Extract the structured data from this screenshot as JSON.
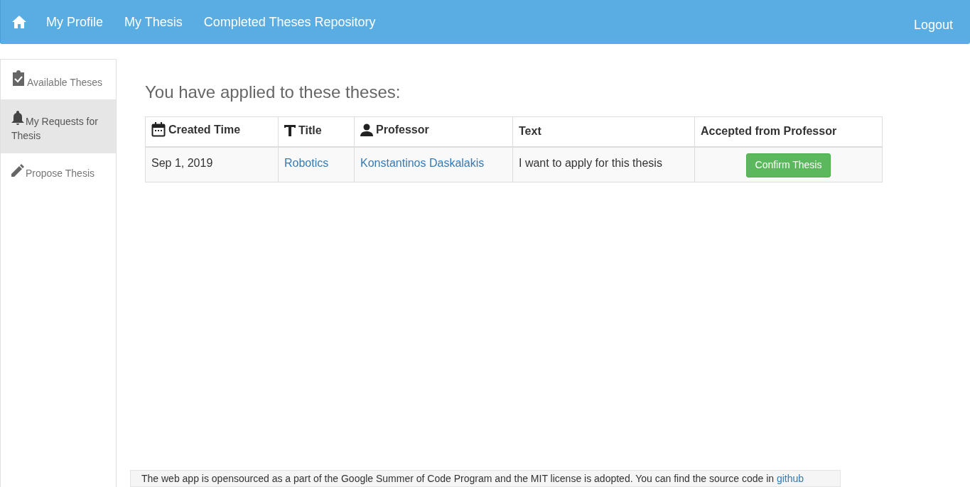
{
  "navbar": {
    "links": [
      {
        "label": "My Profile"
      },
      {
        "label": "My Thesis"
      },
      {
        "label": "Completed Theses Repository"
      }
    ],
    "logout": "Logout"
  },
  "sidebar": {
    "items": [
      {
        "kind": "clipboard",
        "label": "Available Theses",
        "selected": false
      },
      {
        "kind": "bell",
        "label": "My Requests for Thesis",
        "selected": true
      },
      {
        "kind": "pencil",
        "label": "Propose Thesis",
        "selected": false
      }
    ]
  },
  "heading": "You have applied to these theses:",
  "table": {
    "columns": [
      {
        "kind": "calendar",
        "label": "Created Time"
      },
      {
        "kind": "text",
        "label": "Title"
      },
      {
        "kind": "person",
        "label": "Professor"
      },
      {
        "kind": "none",
        "label": "Text"
      },
      {
        "kind": "none",
        "label": "Accepted from Professor"
      }
    ],
    "rows": [
      {
        "created": "Sep 1, 2019",
        "title": "Robotics",
        "professor": "Konstantinos Daskalakis",
        "text": "I want to apply for this thesis",
        "action": "Confirm Thesis"
      }
    ]
  },
  "footer": {
    "text": "The web app is opensourced as a part of the Google Summer of Code Program and the MIT license is adopted. You can find the source code in",
    "link": "github"
  }
}
